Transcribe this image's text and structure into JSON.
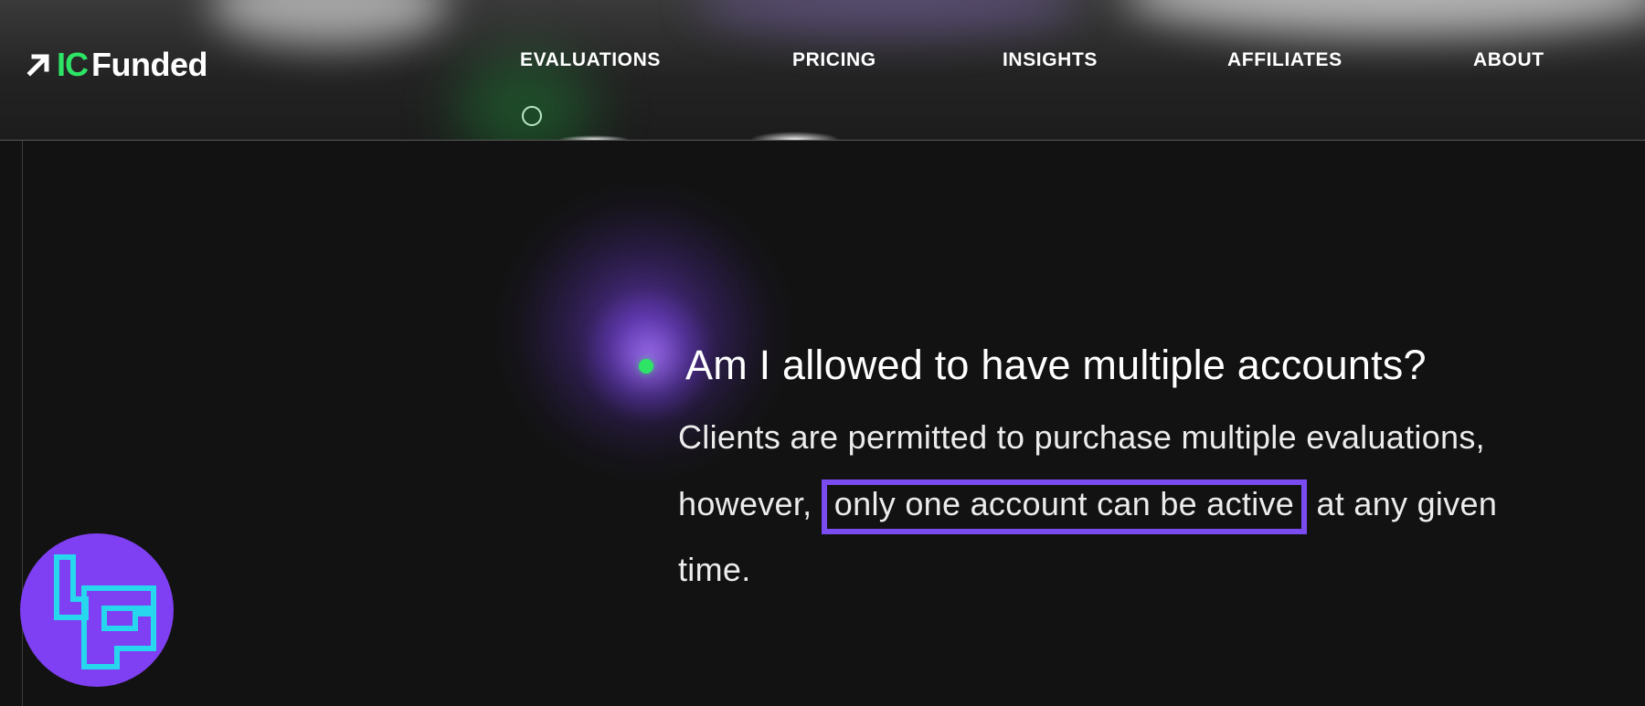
{
  "brand": {
    "ic": "IC",
    "funded": "Funded"
  },
  "nav": {
    "items": [
      {
        "label": "EVALUATIONS"
      },
      {
        "label": "PRICING"
      },
      {
        "label": "INSIGHTS"
      },
      {
        "label": "AFFILIATES"
      },
      {
        "label": "ABOUT"
      }
    ]
  },
  "faq": {
    "question": "Am I allowed to have multiple accounts?",
    "answer": {
      "line1": "Clients are permitted to purchase multiple evaluations,",
      "line2_before": "however, ",
      "line2_highlight": "only one account can be active",
      "line2_after": " at any given",
      "line3": "time."
    }
  },
  "colors": {
    "accent_green": "#2ee466",
    "highlight_purple": "#7a4cf0",
    "badge_purple": "#7f3ff2",
    "badge_glyph_cyan": "#27d7ee",
    "background": "#121212"
  },
  "icons": {
    "logo_arrow": "arrow-up-right-icon",
    "nav_indicator": "circle-outline-icon",
    "faq_bullet": "dot-icon",
    "watermark": "tc-logo-icon"
  }
}
